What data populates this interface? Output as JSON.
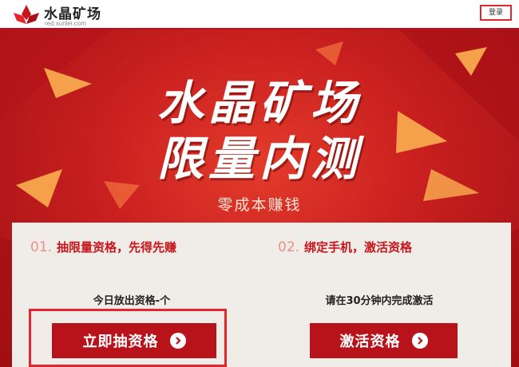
{
  "header": {
    "brand_name": "水晶矿场",
    "brand_domain": "red.xunlei.com",
    "login_label": "登录"
  },
  "hero": {
    "title_line1": "水晶矿场",
    "title_line2": "限量内测",
    "subtitle": "零成本赚钱"
  },
  "steps": [
    {
      "number": "01.",
      "title": "抽限量资格，先得先赚",
      "info": "今日放出资格-个",
      "button_label": "立即抽资格"
    },
    {
      "number": "02.",
      "title": "绑定手机，激活资格",
      "info": "请在30分钟内完成激活",
      "button_label": "激活资格"
    }
  ],
  "colors": {
    "brand_red": "#b8131b",
    "highlight_red": "#e2262d",
    "panel_bg": "#f0ece7"
  }
}
